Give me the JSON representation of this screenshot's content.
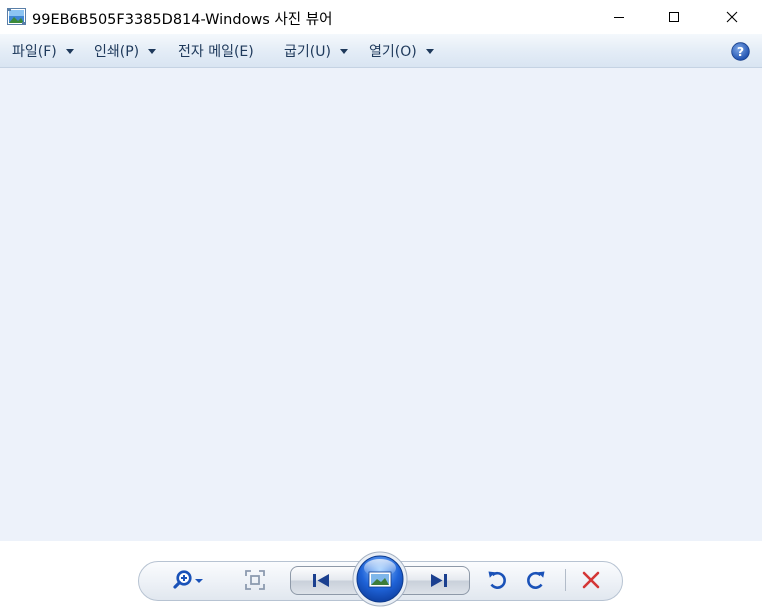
{
  "window": {
    "title": "99EB6B505F3385D814-Windows 사진 뷰어",
    "app_icon": "photo-viewer-icon",
    "controls": {
      "minimize_icon": "minimize-icon",
      "maximize_icon": "maximize-icon",
      "close_icon": "close-icon"
    }
  },
  "menubar": {
    "items": [
      {
        "label": "파일(F)",
        "has_dropdown": true
      },
      {
        "label": "인쇄(P)",
        "has_dropdown": true
      },
      {
        "label": "전자 메일(E)",
        "has_dropdown": false
      },
      {
        "label": "굽기(U)",
        "has_dropdown": true
      },
      {
        "label": "열기(O)",
        "has_dropdown": true
      }
    ],
    "help_icon": "help-icon"
  },
  "viewer": {
    "background_color": "#edf2fa"
  },
  "controlbar": {
    "buttons": [
      {
        "name": "zoom",
        "icon": "magnifier-plus-icon",
        "has_dropdown": true
      },
      {
        "name": "actual-size",
        "icon": "fit-window-icon"
      },
      {
        "name": "previous",
        "icon": "previous-icon"
      },
      {
        "name": "slideshow",
        "icon": "slideshow-icon"
      },
      {
        "name": "next",
        "icon": "next-icon"
      },
      {
        "name": "rotate-counterclockwise",
        "icon": "rotate-left-icon"
      },
      {
        "name": "rotate-clockwise",
        "icon": "rotate-right-icon"
      },
      {
        "name": "delete",
        "icon": "delete-icon"
      }
    ]
  },
  "colors": {
    "menu_text": "#1e395b",
    "accent_blue": "#1f5fc4",
    "delete_red": "#d43636"
  }
}
